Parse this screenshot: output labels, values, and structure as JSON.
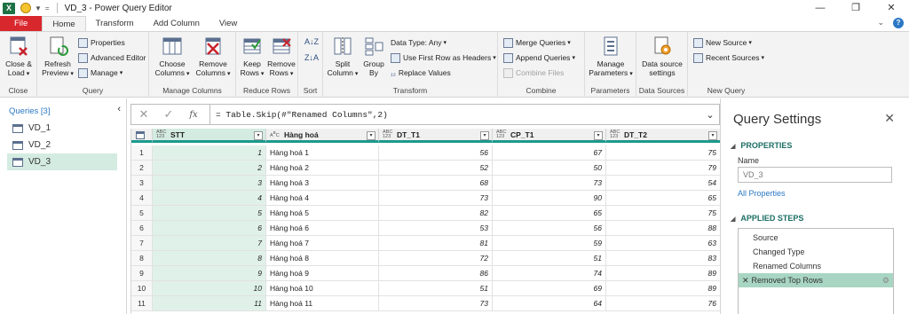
{
  "window": {
    "title": "VD_3 - Power Query Editor",
    "app_icon": "excel-icon",
    "controls": [
      "minimize",
      "restore",
      "close"
    ]
  },
  "tabs": [
    {
      "label": "File",
      "active": false
    },
    {
      "label": "Home",
      "active": true
    },
    {
      "label": "Transform",
      "active": false
    },
    {
      "label": "Add Column",
      "active": false
    },
    {
      "label": "View",
      "active": false
    }
  ],
  "ribbon": {
    "groups": {
      "close": {
        "label": "Close",
        "close_load": "Close &",
        "close_load2": "Load"
      },
      "query": {
        "label": "Query",
        "refresh": "Refresh",
        "refresh2": "Preview",
        "properties": "Properties",
        "advanced_editor": "Advanced Editor",
        "manage": "Manage"
      },
      "manage_columns": {
        "label": "Manage Columns",
        "choose": "Choose",
        "choose2": "Columns",
        "remove": "Remove",
        "remove2": "Columns"
      },
      "reduce_rows": {
        "label": "Reduce Rows",
        "keep": "Keep",
        "keep2": "Rows",
        "remove": "Remove",
        "remove2": "Rows"
      },
      "sort": {
        "label": "Sort"
      },
      "transform": {
        "label": "Transform",
        "split": "Split",
        "split2": "Column",
        "group": "Group",
        "group2": "By",
        "data_type": "Data Type: Any",
        "first_row": "Use First Row as Headers",
        "replace": "Replace Values"
      },
      "combine": {
        "label": "Combine",
        "merge": "Merge Queries",
        "append": "Append Queries",
        "combine_files": "Combine Files"
      },
      "parameters": {
        "label": "Parameters",
        "manage": "Manage",
        "manage2": "Parameters"
      },
      "data_sources": {
        "label": "Data Sources",
        "settings": "Data source",
        "settings2": "settings"
      },
      "new_query": {
        "label": "New Query",
        "new_source": "New Source",
        "recent_sources": "Recent Sources"
      }
    }
  },
  "queries_pane": {
    "header": "Queries [3]",
    "items": [
      {
        "name": "VD_1",
        "selected": false
      },
      {
        "name": "VD_2",
        "selected": false
      },
      {
        "name": "VD_3",
        "selected": true
      }
    ]
  },
  "formula_bar": {
    "fx": "fx",
    "text": "= Table.Skip(#\"Renamed Columns\",2)"
  },
  "table": {
    "columns": [
      {
        "name": "STT",
        "type": "ABC\n123"
      },
      {
        "name": "Hàng hoá",
        "type": "ABC"
      },
      {
        "name": "DT_T1",
        "type": "ABC\n123"
      },
      {
        "name": "CP_T1",
        "type": "ABC\n123"
      },
      {
        "name": "DT_T2",
        "type": "ABC\n123"
      }
    ],
    "rows": [
      [
        "1",
        "1",
        "Hàng hoá 1",
        "56",
        "67",
        "75"
      ],
      [
        "2",
        "2",
        "Hàng hoá 2",
        "52",
        "50",
        "79"
      ],
      [
        "3",
        "3",
        "Hàng hoá 3",
        "68",
        "73",
        "54"
      ],
      [
        "4",
        "4",
        "Hàng hoá 4",
        "73",
        "90",
        "65"
      ],
      [
        "5",
        "5",
        "Hàng hoá 5",
        "82",
        "65",
        "75"
      ],
      [
        "6",
        "6",
        "Hàng hoá 6",
        "53",
        "56",
        "88"
      ],
      [
        "7",
        "7",
        "Hàng hoá 7",
        "81",
        "59",
        "63"
      ],
      [
        "8",
        "8",
        "Hàng hoá 8",
        "72",
        "51",
        "83"
      ],
      [
        "9",
        "9",
        "Hàng hoá 9",
        "86",
        "74",
        "89"
      ],
      [
        "10",
        "10",
        "Hàng hoá 10",
        "51",
        "69",
        "89"
      ],
      [
        "11",
        "11",
        "Hàng hoá 11",
        "73",
        "64",
        "76"
      ]
    ]
  },
  "query_settings": {
    "title": "Query Settings",
    "properties_title": "PROPERTIES",
    "name_label": "Name",
    "name_value": "VD_3",
    "all_properties": "All Properties",
    "applied_steps_title": "APPLIED STEPS",
    "steps": [
      {
        "label": "Source",
        "selected": false
      },
      {
        "label": "Changed Type",
        "selected": false
      },
      {
        "label": "Renamed Columns",
        "selected": false
      },
      {
        "label": "Removed Top Rows",
        "selected": true
      }
    ]
  },
  "colors": {
    "file_tab": "#d9272e",
    "accent": "#1b9a8c",
    "selection": "#d4ebe1",
    "link": "#2b78c5"
  }
}
